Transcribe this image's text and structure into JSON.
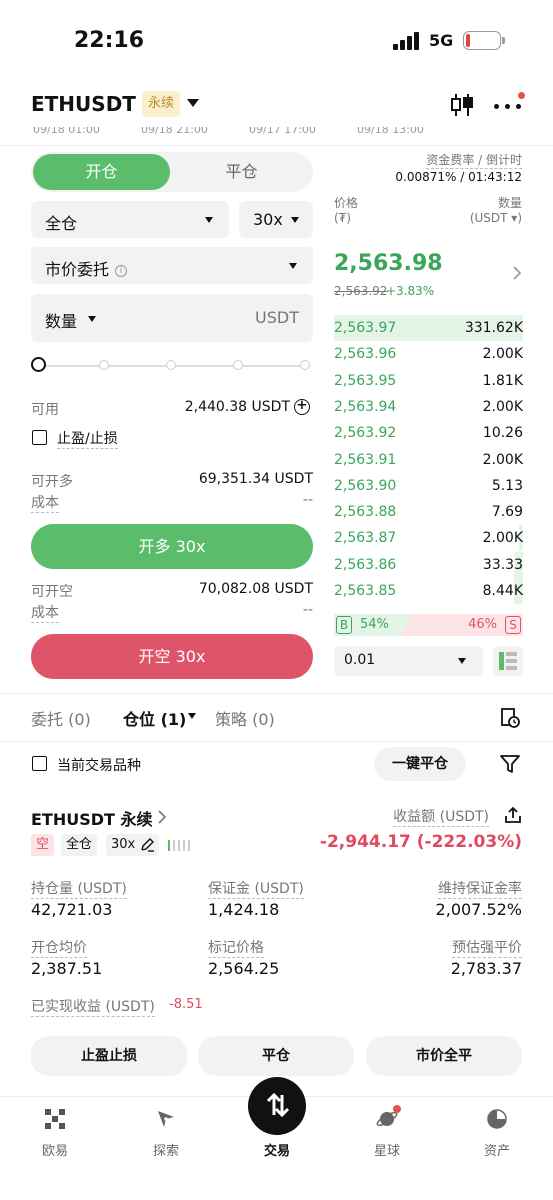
{
  "status_bar": {
    "time": "22:16",
    "network": "5G"
  },
  "header": {
    "symbol": "ETHUSDT",
    "badge": "永续"
  },
  "chart_ticks": [
    "09/18 01:00",
    "09/18 21:00",
    "09/17 17:00",
    "09/18 13:00"
  ],
  "order_panel": {
    "tab_open": "开仓",
    "tab_close": "平仓",
    "margin_mode": "全仓",
    "leverage": "30x",
    "order_type": "市价委托",
    "qty_label": "数量",
    "qty_unit": "USDT",
    "available_label": "可用",
    "available_value": "2,440.38 USDT",
    "tpsl_label": "止盈/止损",
    "can_long_label": "可开多",
    "can_long_value": "69,351.34 USDT",
    "cost_label": "成本",
    "cost_value": "--",
    "long_button": "开多 30x",
    "can_short_label": "可开空",
    "can_short_value": "70,082.08 USDT",
    "cost_label_2": "成本",
    "cost_value_2": "--",
    "short_button": "开空 30x",
    "slider_fraction": 0
  },
  "order_book": {
    "funding_label": "资金费率 / 倒计时",
    "funding_value": "0.00871% / 01:43:12",
    "price_header": "价格",
    "price_unit": "(₮)",
    "amount_header": "数量",
    "amount_unit": "(USDT ▾)",
    "last_price": "2,563.98",
    "mark_price": "2,563.92",
    "change": "+3.83%",
    "rows": [
      {
        "price": "2,563.97",
        "amount": "331.62K",
        "depth": 1.0
      },
      {
        "price": "2,563.96",
        "amount": "2.00K",
        "depth": 0
      },
      {
        "price": "2,563.95",
        "amount": "1.81K",
        "depth": 0
      },
      {
        "price": "2,563.94",
        "amount": "2.00K",
        "depth": 0
      },
      {
        "price": "2,563.92",
        "amount": "10.26",
        "depth": 0
      },
      {
        "price": "2,563.91",
        "amount": "2.00K",
        "depth": 0
      },
      {
        "price": "2,563.90",
        "amount": "5.13",
        "depth": 0
      },
      {
        "price": "2,563.88",
        "amount": "7.69",
        "depth": 0
      },
      {
        "price": "2,563.87",
        "amount": "2.00K",
        "depth": 0.02
      },
      {
        "price": "2,563.86",
        "amount": "33.33",
        "depth": 0.05
      },
      {
        "price": "2,563.85",
        "amount": "8.44K",
        "depth": 0.05
      }
    ],
    "buy_label": "B",
    "buy_ratio": "54%",
    "sell_ratio": "46%",
    "sell_label": "S",
    "precision": "0.01"
  },
  "bottom_tabs": {
    "orders": "委托 (0)",
    "positions": "仓位 (1)",
    "strategies": "策略 (0)"
  },
  "position_filter": {
    "current_only": "当前交易品种",
    "close_all": "一键平仓"
  },
  "position": {
    "title": "ETHUSDT 永续",
    "side_tag": "空",
    "margin_tag": "全仓",
    "leverage_tag": "30x",
    "pnl_label": "收益额 (USDT)",
    "pnl_value": "-2,944.17 (-222.03%)",
    "size_label": "持仓量 (USDT)",
    "size_value": "42,721.03",
    "margin_label": "保证金 (USDT)",
    "margin_value": "1,424.18",
    "mmr_label": "维持保证金率",
    "mmr_value": "2,007.52%",
    "entry_label": "开仓均价",
    "entry_value": "2,387.51",
    "mark_label": "标记价格",
    "mark_value": "2,564.25",
    "liq_label": "预估强平价",
    "liq_value": "2,783.37",
    "realized_label": "已实现收益 (USDT)",
    "realized_value": "-8.51",
    "btn_tpsl": "止盈止损",
    "btn_close": "平仓",
    "btn_market_close": "市价全平"
  },
  "nav": [
    {
      "label": "欧易",
      "icon": "okx-logo-icon"
    },
    {
      "label": "探索",
      "icon": "compass-icon"
    },
    {
      "label": "交易",
      "icon": "swap-arrows-icon"
    },
    {
      "label": "星球",
      "icon": "planet-icon"
    },
    {
      "label": "资产",
      "icon": "pie-chart-icon"
    }
  ],
  "colors": {
    "green": "#5bbd6b",
    "red": "#de5468",
    "price_green": "#3aa55b",
    "pnl_red": "#e04a5e"
  }
}
